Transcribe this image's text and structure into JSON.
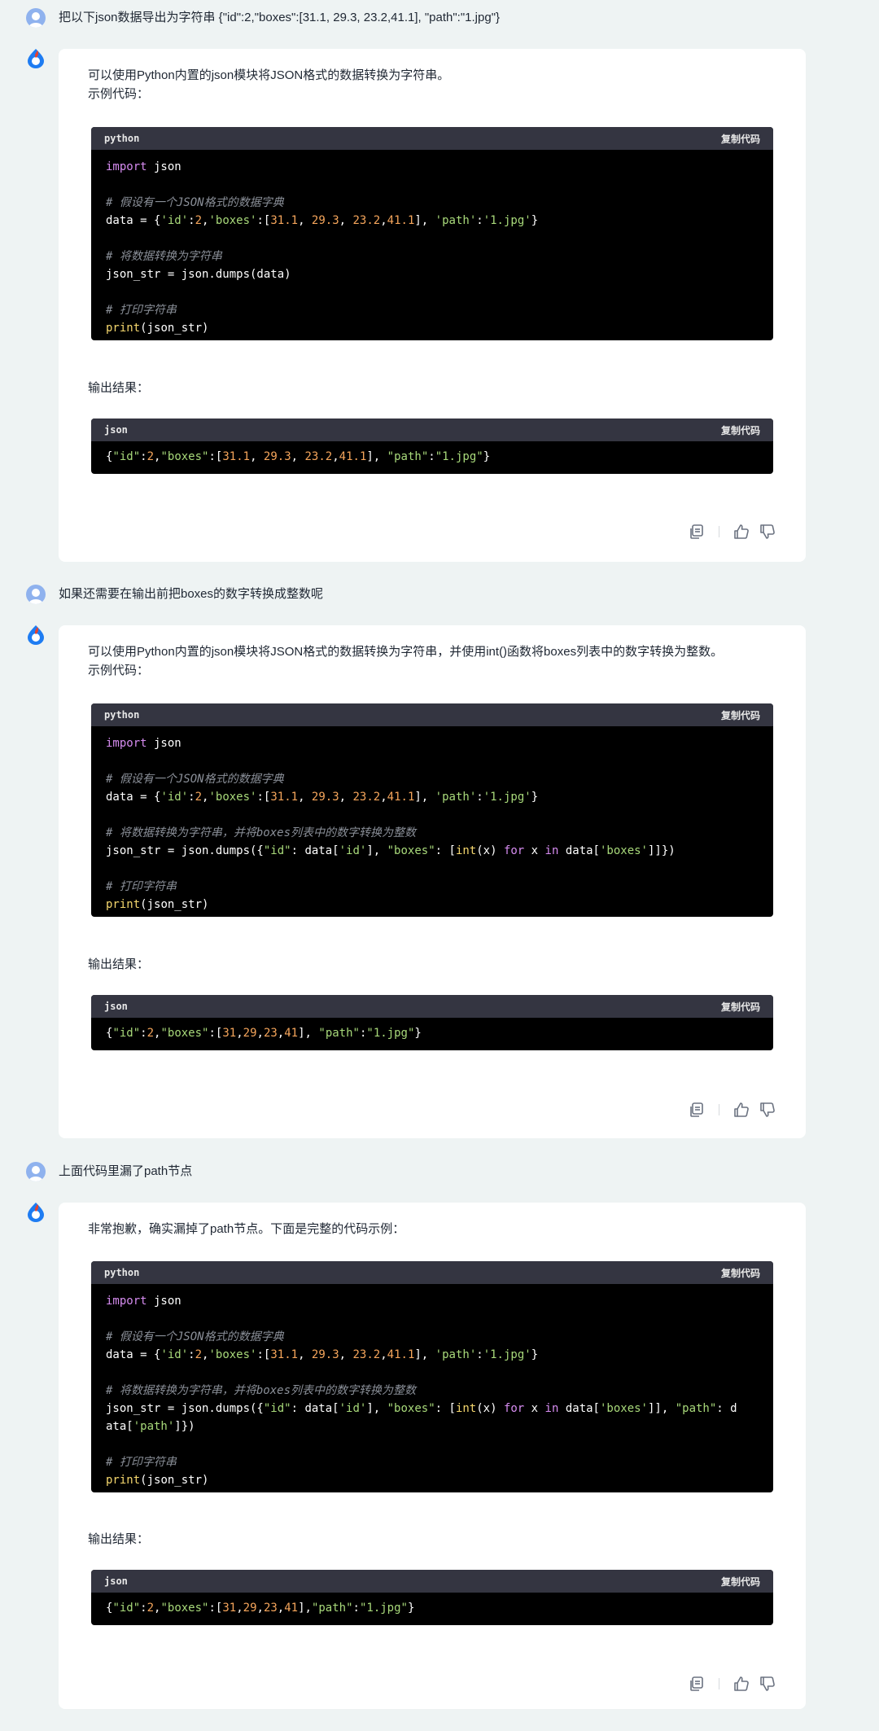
{
  "conversation": {
    "q1": "把以下json数据导出为字符串 {\"id\":2,\"boxes\":[31.1, 29.3, 23.2,41.1], \"path\":\"1.jpg\"}",
    "a1": {
      "intro": "可以使用Python内置的json模块将JSON格式的数据转换为字符串。",
      "example_label": "示例代码：",
      "code_lang": "python",
      "output_label": "输出结果：",
      "output_lang": "json"
    },
    "q2": "如果还需要在输出前把boxes的数字转换成整数呢",
    "a2": {
      "intro": "可以使用Python内置的json模块将JSON格式的数据转换为字符串，并使用int()函数将boxes列表中的数字转换为整数。",
      "example_label": "示例代码：",
      "code_lang": "python",
      "output_label": "输出结果：",
      "output_lang": "json"
    },
    "q3": "上面代码里漏了path节点",
    "a3": {
      "intro": "非常抱歉，确实漏掉了path节点。下面是完整的代码示例：",
      "code_lang": "python",
      "output_label": "输出结果：",
      "output_lang": "json"
    },
    "copy_label": "复制代码",
    "code": {
      "import": "import json",
      "cm_dict": "# 假设有一个JSON格式的数据字典",
      "cm_convert": "# 将数据转换为字符串",
      "cm_convert_int": "# 将数据转换为字符串，并将boxes列表中的数字转换为整数",
      "cm_print": "# 打印字符串",
      "dumps1": "json_str = json.dumps(data)",
      "print": "print(json_str)"
    }
  },
  "icons": [
    "user-avatar-icon",
    "bot-logo-icon",
    "copy-icon",
    "thumbs-up-icon",
    "thumbs-down-icon"
  ],
  "colors": {
    "background": "#eef3f3",
    "card": "#ffffff",
    "code_bg": "#000000",
    "code_header": "#343541",
    "avatar_user": "#8fb2ee",
    "bot_blue": "#1e7cf2",
    "bot_red": "#e8412c"
  }
}
